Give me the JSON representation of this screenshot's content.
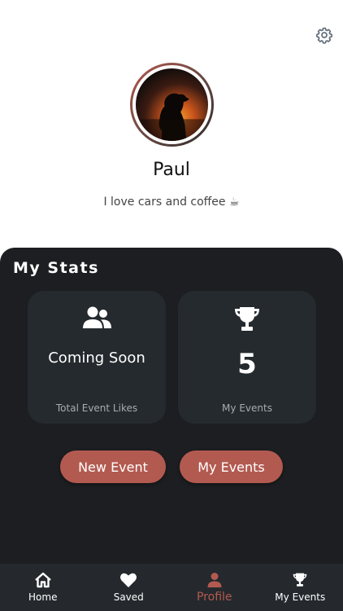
{
  "header": {
    "settings_icon": "gear-icon"
  },
  "profile": {
    "name": "Paul",
    "bio": "I love cars and coffee ☕"
  },
  "stats": {
    "title": "My Stats",
    "cards": [
      {
        "icon": "people-icon",
        "value": "Coming Soon",
        "caption": "Total Event Likes"
      },
      {
        "icon": "trophy-icon",
        "value": "5",
        "caption": "My Events"
      }
    ]
  },
  "actions": {
    "new_event": "New Event",
    "my_events": "My Events"
  },
  "nav": {
    "items": [
      {
        "label": "Home",
        "icon": "home-icon"
      },
      {
        "label": "Saved",
        "icon": "heart-icon"
      },
      {
        "label": "Profile",
        "icon": "person-icon",
        "active": true
      },
      {
        "label": "My Events",
        "icon": "trophy-icon"
      }
    ]
  },
  "colors": {
    "accent": "#b35a50",
    "panel": "#1c1e21",
    "card": "#252a2e",
    "nav": "#25292d"
  }
}
